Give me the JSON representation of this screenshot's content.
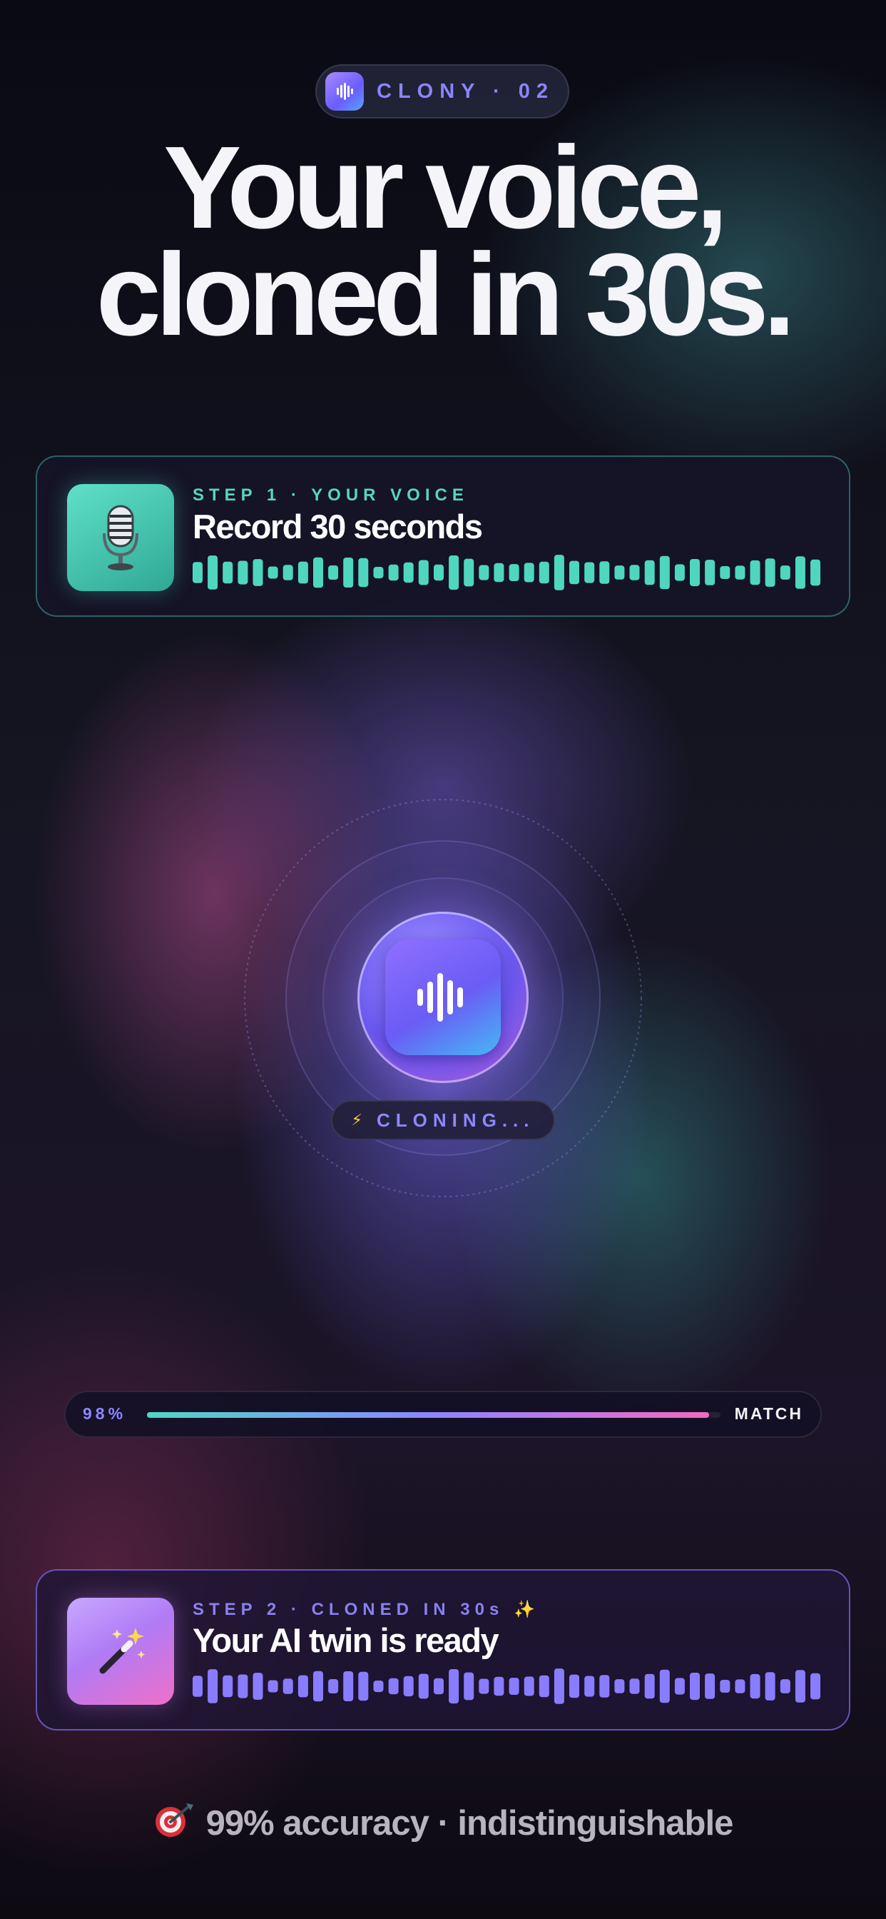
{
  "badge": {
    "icon": "waveform-icon",
    "text": "CLONY · 02"
  },
  "headline": {
    "line1": "Your voice,",
    "line2": "cloned in 30s."
  },
  "step1": {
    "icon": "microphone-icon",
    "label": "STEP 1 · YOUR VOICE",
    "title": "Record 30 seconds",
    "wave_color": "#4fd6bf"
  },
  "center": {
    "icon": "waveform-icon",
    "status_icon": "lightning-icon",
    "status": "CLONING..."
  },
  "progress": {
    "percent_label": "98%",
    "value": 0.98,
    "suffix": "MATCH"
  },
  "step2": {
    "icon": "magic-wand-icon",
    "label": "STEP 2 · CLONED IN 30s ✨",
    "title": "Your AI twin is ready",
    "wave_color": "#8a7cff"
  },
  "footer": {
    "icon": "target-icon",
    "text": "99% accuracy · indistinguishable"
  }
}
